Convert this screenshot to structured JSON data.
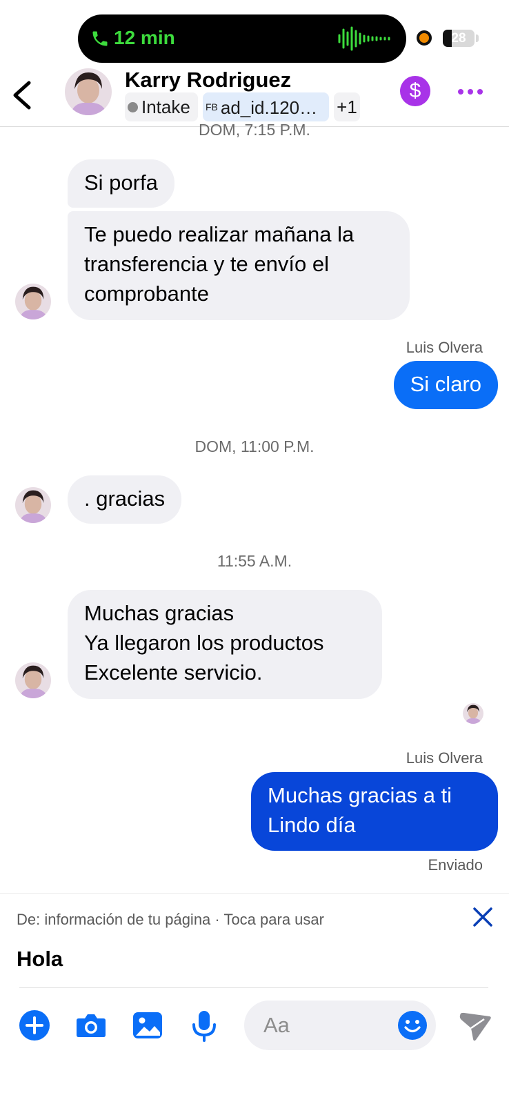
{
  "status": {
    "call_duration": "12 min",
    "battery_level": "28",
    "battery_fraction": 0.28,
    "accent_green": "#3ddc3d"
  },
  "header": {
    "contact_name": "Karry Rodriguez",
    "chips": {
      "label_status": "Intake",
      "ad_source": "FB",
      "ad_label": "ad_id.120…",
      "more_count": "+1"
    },
    "pay_icon": "dollar-icon",
    "menu_icon": "more-icon"
  },
  "thread": {
    "stamp_1": "DOM, 7:15 P.M.",
    "msg_1": "Si porfa",
    "msg_2": {
      "line1": "Te puedo realizar mañana la",
      "line2": "transferencia y te envío el",
      "line3": "comprobante"
    },
    "sender_1": "Luis Olvera",
    "msg_3": "Si claro",
    "stamp_2": "DOM, 11:00 P.M.",
    "msg_4": ". gracias",
    "stamp_3": "11:55 A.M.",
    "msg_5": {
      "line1": "Muchas gracias",
      "line2": "Ya llegaron los productos",
      "line3": "Excelente servicio."
    },
    "sender_2": "Luis Olvera",
    "msg_6": {
      "line1": "Muchas gracias a ti",
      "line2": "Lindo día"
    },
    "delivery_status": "Enviado"
  },
  "suggestion": {
    "source_text": "De: información de tu página · Toca para usar",
    "text": "Hola"
  },
  "composer": {
    "placeholder": "Aa",
    "brand_blue": "#0a6ef7"
  }
}
